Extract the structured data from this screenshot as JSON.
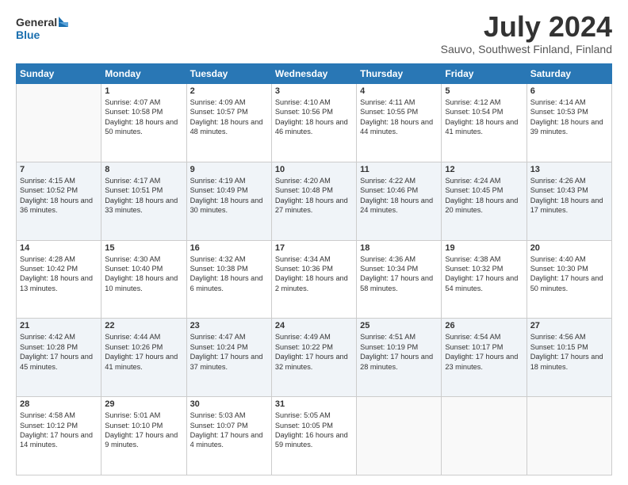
{
  "logo": {
    "line1": "General",
    "line2": "Blue"
  },
  "header": {
    "month": "July 2024",
    "location": "Sauvo, Southwest Finland, Finland"
  },
  "weekdays": [
    "Sunday",
    "Monday",
    "Tuesday",
    "Wednesday",
    "Thursday",
    "Friday",
    "Saturday"
  ],
  "weeks": [
    [
      {
        "day": "",
        "sunrise": "",
        "sunset": "",
        "daylight": ""
      },
      {
        "day": "1",
        "sunrise": "Sunrise: 4:07 AM",
        "sunset": "Sunset: 10:58 PM",
        "daylight": "Daylight: 18 hours and 50 minutes."
      },
      {
        "day": "2",
        "sunrise": "Sunrise: 4:09 AM",
        "sunset": "Sunset: 10:57 PM",
        "daylight": "Daylight: 18 hours and 48 minutes."
      },
      {
        "day": "3",
        "sunrise": "Sunrise: 4:10 AM",
        "sunset": "Sunset: 10:56 PM",
        "daylight": "Daylight: 18 hours and 46 minutes."
      },
      {
        "day": "4",
        "sunrise": "Sunrise: 4:11 AM",
        "sunset": "Sunset: 10:55 PM",
        "daylight": "Daylight: 18 hours and 44 minutes."
      },
      {
        "day": "5",
        "sunrise": "Sunrise: 4:12 AM",
        "sunset": "Sunset: 10:54 PM",
        "daylight": "Daylight: 18 hours and 41 minutes."
      },
      {
        "day": "6",
        "sunrise": "Sunrise: 4:14 AM",
        "sunset": "Sunset: 10:53 PM",
        "daylight": "Daylight: 18 hours and 39 minutes."
      }
    ],
    [
      {
        "day": "7",
        "sunrise": "Sunrise: 4:15 AM",
        "sunset": "Sunset: 10:52 PM",
        "daylight": "Daylight: 18 hours and 36 minutes."
      },
      {
        "day": "8",
        "sunrise": "Sunrise: 4:17 AM",
        "sunset": "Sunset: 10:51 PM",
        "daylight": "Daylight: 18 hours and 33 minutes."
      },
      {
        "day": "9",
        "sunrise": "Sunrise: 4:19 AM",
        "sunset": "Sunset: 10:49 PM",
        "daylight": "Daylight: 18 hours and 30 minutes."
      },
      {
        "day": "10",
        "sunrise": "Sunrise: 4:20 AM",
        "sunset": "Sunset: 10:48 PM",
        "daylight": "Daylight: 18 hours and 27 minutes."
      },
      {
        "day": "11",
        "sunrise": "Sunrise: 4:22 AM",
        "sunset": "Sunset: 10:46 PM",
        "daylight": "Daylight: 18 hours and 24 minutes."
      },
      {
        "day": "12",
        "sunrise": "Sunrise: 4:24 AM",
        "sunset": "Sunset: 10:45 PM",
        "daylight": "Daylight: 18 hours and 20 minutes."
      },
      {
        "day": "13",
        "sunrise": "Sunrise: 4:26 AM",
        "sunset": "Sunset: 10:43 PM",
        "daylight": "Daylight: 18 hours and 17 minutes."
      }
    ],
    [
      {
        "day": "14",
        "sunrise": "Sunrise: 4:28 AM",
        "sunset": "Sunset: 10:42 PM",
        "daylight": "Daylight: 18 hours and 13 minutes."
      },
      {
        "day": "15",
        "sunrise": "Sunrise: 4:30 AM",
        "sunset": "Sunset: 10:40 PM",
        "daylight": "Daylight: 18 hours and 10 minutes."
      },
      {
        "day": "16",
        "sunrise": "Sunrise: 4:32 AM",
        "sunset": "Sunset: 10:38 PM",
        "daylight": "Daylight: 18 hours and 6 minutes."
      },
      {
        "day": "17",
        "sunrise": "Sunrise: 4:34 AM",
        "sunset": "Sunset: 10:36 PM",
        "daylight": "Daylight: 18 hours and 2 minutes."
      },
      {
        "day": "18",
        "sunrise": "Sunrise: 4:36 AM",
        "sunset": "Sunset: 10:34 PM",
        "daylight": "Daylight: 17 hours and 58 minutes."
      },
      {
        "day": "19",
        "sunrise": "Sunrise: 4:38 AM",
        "sunset": "Sunset: 10:32 PM",
        "daylight": "Daylight: 17 hours and 54 minutes."
      },
      {
        "day": "20",
        "sunrise": "Sunrise: 4:40 AM",
        "sunset": "Sunset: 10:30 PM",
        "daylight": "Daylight: 17 hours and 50 minutes."
      }
    ],
    [
      {
        "day": "21",
        "sunrise": "Sunrise: 4:42 AM",
        "sunset": "Sunset: 10:28 PM",
        "daylight": "Daylight: 17 hours and 45 minutes."
      },
      {
        "day": "22",
        "sunrise": "Sunrise: 4:44 AM",
        "sunset": "Sunset: 10:26 PM",
        "daylight": "Daylight: 17 hours and 41 minutes."
      },
      {
        "day": "23",
        "sunrise": "Sunrise: 4:47 AM",
        "sunset": "Sunset: 10:24 PM",
        "daylight": "Daylight: 17 hours and 37 minutes."
      },
      {
        "day": "24",
        "sunrise": "Sunrise: 4:49 AM",
        "sunset": "Sunset: 10:22 PM",
        "daylight": "Daylight: 17 hours and 32 minutes."
      },
      {
        "day": "25",
        "sunrise": "Sunrise: 4:51 AM",
        "sunset": "Sunset: 10:19 PM",
        "daylight": "Daylight: 17 hours and 28 minutes."
      },
      {
        "day": "26",
        "sunrise": "Sunrise: 4:54 AM",
        "sunset": "Sunset: 10:17 PM",
        "daylight": "Daylight: 17 hours and 23 minutes."
      },
      {
        "day": "27",
        "sunrise": "Sunrise: 4:56 AM",
        "sunset": "Sunset: 10:15 PM",
        "daylight": "Daylight: 17 hours and 18 minutes."
      }
    ],
    [
      {
        "day": "28",
        "sunrise": "Sunrise: 4:58 AM",
        "sunset": "Sunset: 10:12 PM",
        "daylight": "Daylight: 17 hours and 14 minutes."
      },
      {
        "day": "29",
        "sunrise": "Sunrise: 5:01 AM",
        "sunset": "Sunset: 10:10 PM",
        "daylight": "Daylight: 17 hours and 9 minutes."
      },
      {
        "day": "30",
        "sunrise": "Sunrise: 5:03 AM",
        "sunset": "Sunset: 10:07 PM",
        "daylight": "Daylight: 17 hours and 4 minutes."
      },
      {
        "day": "31",
        "sunrise": "Sunrise: 5:05 AM",
        "sunset": "Sunset: 10:05 PM",
        "daylight": "Daylight: 16 hours and 59 minutes."
      },
      {
        "day": "",
        "sunrise": "",
        "sunset": "",
        "daylight": ""
      },
      {
        "day": "",
        "sunrise": "",
        "sunset": "",
        "daylight": ""
      },
      {
        "day": "",
        "sunrise": "",
        "sunset": "",
        "daylight": ""
      }
    ]
  ]
}
